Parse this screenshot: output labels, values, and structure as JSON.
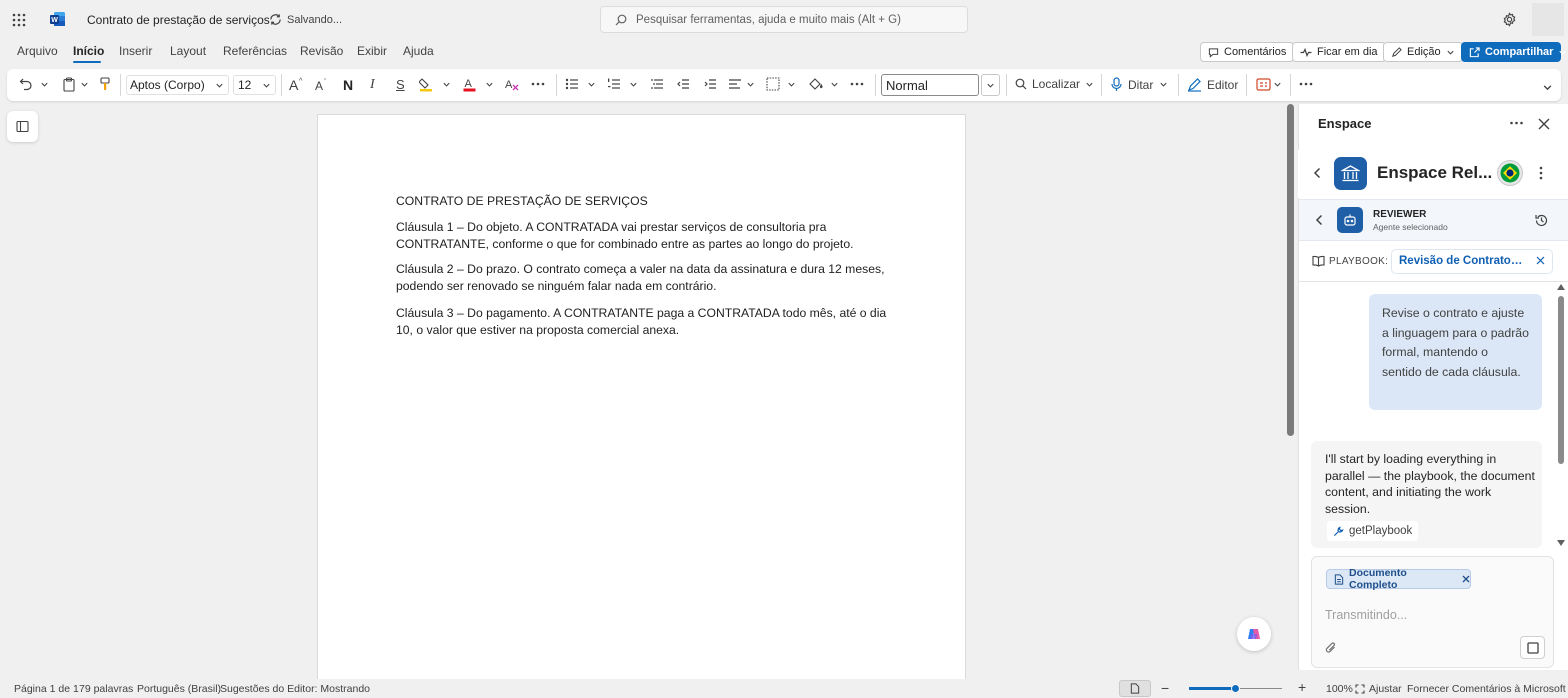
{
  "titlebar": {
    "doc_title": "Contrato de prestação de serviços",
    "save_status": "Salvando...",
    "search_placeholder": "Pesquisar ferramentas, ajuda e muito mais (Alt + G)"
  },
  "menu": {
    "items": [
      "Arquivo",
      "Início",
      "Inserir",
      "Layout",
      "Referências",
      "Revisão",
      "Exibir",
      "Ajuda"
    ],
    "active": "Início",
    "comments_label": "Comentários",
    "catchup_label": "Ficar em dia",
    "editing_label": "Edição",
    "share_label": "Compartilhar"
  },
  "ribbon": {
    "font_name": "Aptos (Corpo)",
    "font_size": "12",
    "bold_glyph": "N",
    "italic_glyph": "I",
    "strike_glyph": "S",
    "style_value": "Normal",
    "find_label": "Localizar",
    "dictate_label": "Ditar",
    "editor_label": "Editor",
    "font_color": "#e81123",
    "accent": "#0f6cbd"
  },
  "document": {
    "title": "CONTRATO DE PRESTAÇÃO DE SERVIÇOS",
    "paragraphs": [
      "Cláusula 1 – Do objeto. A CONTRATADA vai prestar serviços de consultoria pra CONTRATANTE, conforme o que for combinado entre as partes ao longo do projeto.",
      "Cláusula 2 – Do prazo. O contrato começa a valer na data da assinatura e dura 12 meses, podendo ser renovado se ninguém falar nada em contrário.",
      "Cláusula 3 – Do pagamento. A CONTRATANTE paga a CONTRATADA todo mês, até o dia 10, o valor que estiver na proposta comercial anexa."
    ]
  },
  "panel": {
    "title": "Enspace",
    "app_name": "Enspace Rel...",
    "agent_name": "REVIEWER",
    "agent_status": "Agente selecionado",
    "playbook_label": "PLAYBOOK:",
    "playbook_value": "Revisão de Contrato d...",
    "user_message": "Revise o contrato e ajuste a linguagem para o padrão formal, mantendo o sentido de cada cláusula.",
    "assistant_message": "I'll start by loading everything in parallel — the playbook, the document content, and initiating the work session.",
    "tool_call": "getPlaybook",
    "context_chip": "Documento Completo",
    "composer_placeholder": "Transmitindo..."
  },
  "statusbar": {
    "page": "Página 1 de 1",
    "words": "79 palavras",
    "language": "Português (Brasil)",
    "editor_suggestions": "Sugestões do Editor: Mostrando",
    "zoom_level": "100%",
    "zoom_fraction": 0.5,
    "fit_label": "Ajustar",
    "feedback": "Fornecer Comentários à Microsoft"
  }
}
